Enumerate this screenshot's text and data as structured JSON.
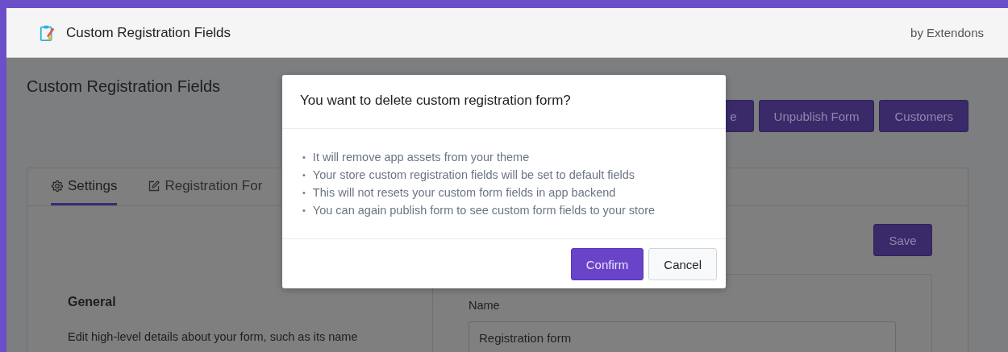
{
  "header": {
    "title": "Custom Registration Fields",
    "vendor": "by Extendons"
  },
  "page": {
    "title": "Custom Registration Fields",
    "actions": [
      {
        "label": "e"
      },
      {
        "label": "Unpublish Form"
      },
      {
        "label": "Customers"
      }
    ]
  },
  "tabs": [
    {
      "label": "Settings",
      "selected": true
    },
    {
      "label": "Registration For",
      "selected": false
    }
  ],
  "save": "Save",
  "general": {
    "heading": "General",
    "description": "Edit high-level details about your form, such as its name"
  },
  "name_field": {
    "label": "Name",
    "value": "Registration form"
  },
  "modal": {
    "title": "You want to delete custom registration form?",
    "items": [
      {
        "bullet": "•",
        "text": "It will remove app assets from your theme"
      },
      {
        "bullet": "•",
        "text": "Your store custom registration fields will be set to default fields"
      },
      {
        "bullet": "•",
        "text": "This will not resets your custom form fields in app backend"
      },
      {
        "bullet": "•",
        "text": "You can again publish form to see custom form fields to your store"
      }
    ],
    "buttons": [
      {
        "label": "Confirm",
        "kind": "primary"
      },
      {
        "label": "Cancel",
        "kind": "secondary"
      }
    ]
  }
}
